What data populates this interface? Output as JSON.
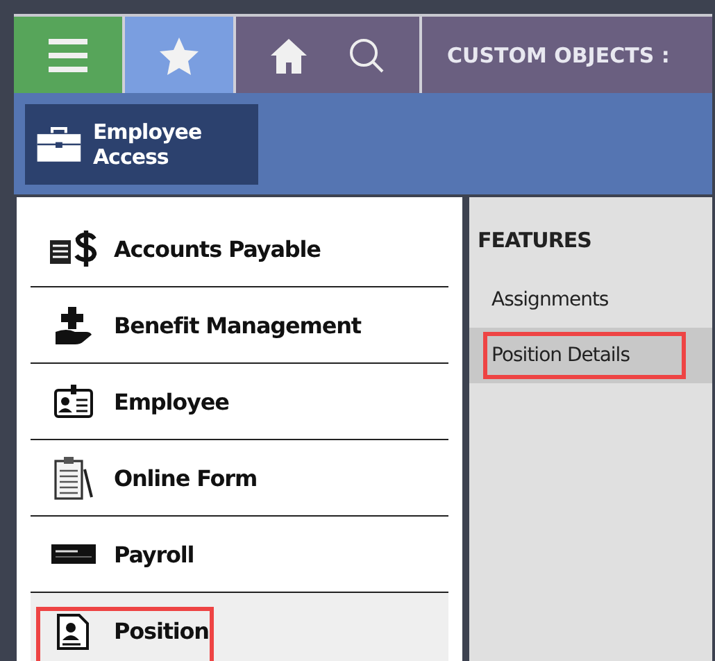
{
  "top_bar": {
    "title": "CUSTOM OBJECTS :"
  },
  "sub_bar": {
    "button": "Employee Access"
  },
  "sidebar": {
    "items": [
      {
        "label": "Accounts Payable",
        "kind": "money",
        "selected": false,
        "highlighted": false
      },
      {
        "label": "Benefit Management",
        "kind": "benefit",
        "selected": false,
        "highlighted": false
      },
      {
        "label": "Employee",
        "kind": "idcard",
        "selected": false,
        "highlighted": false
      },
      {
        "label": "Online Form",
        "kind": "form",
        "selected": false,
        "highlighted": false
      },
      {
        "label": "Payroll",
        "kind": "check",
        "selected": false,
        "highlighted": false
      },
      {
        "label": "Position",
        "kind": "position",
        "selected": true,
        "highlighted": true
      }
    ]
  },
  "features": {
    "heading": "FEATURES",
    "items": [
      {
        "label": "Assignments",
        "selected": false,
        "highlighted": false
      },
      {
        "label": "Position Details",
        "selected": true,
        "highlighted": true
      }
    ]
  }
}
